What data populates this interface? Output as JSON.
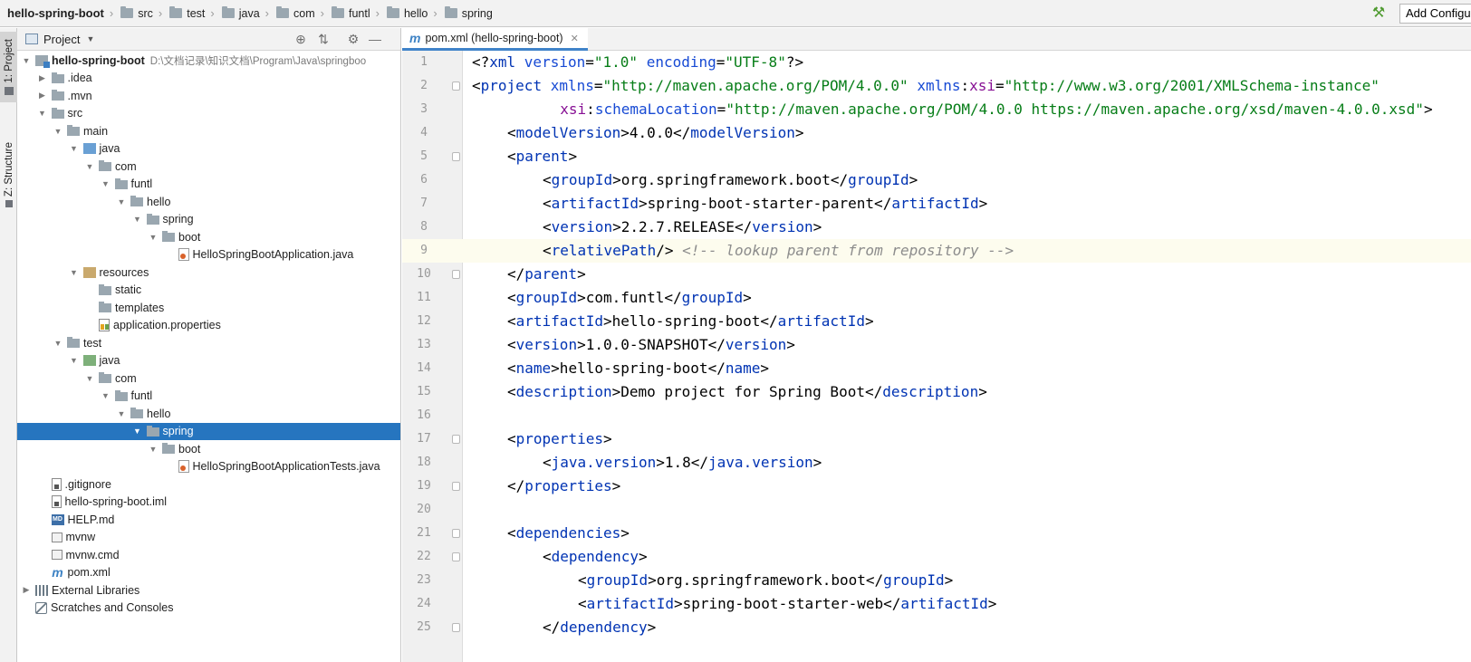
{
  "breadcrumbs": [
    {
      "label": "hello-spring-boot",
      "icon": "folder-icon"
    },
    {
      "label": "src",
      "icon": "folder-icon"
    },
    {
      "label": "test",
      "icon": "folder-icon"
    },
    {
      "label": "java",
      "icon": "folder-icon"
    },
    {
      "label": "com",
      "icon": "folder-icon"
    },
    {
      "label": "funtl",
      "icon": "folder-icon"
    },
    {
      "label": "hello",
      "icon": "folder-icon"
    },
    {
      "label": "spring",
      "icon": "folder-icon"
    }
  ],
  "toolbar": {
    "build_icon": "hammer-icon",
    "add_config_label": "Add Configu"
  },
  "tool_strip": {
    "project_tab": "1: Project",
    "structure_tab": "Z: Structure"
  },
  "project_panel": {
    "title": "Project",
    "header_icons": [
      "locate-icon",
      "collapse-icon",
      "gear-icon",
      "minimize-icon"
    ],
    "tree": [
      {
        "label": "hello-spring-boot",
        "path": "D:\\文档记录\\知识文档\\Program\\Java\\springboo",
        "depth": 0,
        "arrow": "down",
        "icon": "module",
        "bold": true
      },
      {
        "label": ".idea",
        "depth": 1,
        "arrow": "right",
        "icon": "folder"
      },
      {
        "label": ".mvn",
        "depth": 1,
        "arrow": "right",
        "icon": "folder"
      },
      {
        "label": "src",
        "depth": 1,
        "arrow": "down",
        "icon": "folder"
      },
      {
        "label": "main",
        "depth": 2,
        "arrow": "down",
        "icon": "folder"
      },
      {
        "label": "java",
        "depth": 3,
        "arrow": "down",
        "icon": "folder-src"
      },
      {
        "label": "com",
        "depth": 4,
        "arrow": "down",
        "icon": "folder"
      },
      {
        "label": "funtl",
        "depth": 5,
        "arrow": "down",
        "icon": "folder"
      },
      {
        "label": "hello",
        "depth": 6,
        "arrow": "down",
        "icon": "folder"
      },
      {
        "label": "spring",
        "depth": 7,
        "arrow": "down",
        "icon": "folder"
      },
      {
        "label": "boot",
        "depth": 8,
        "arrow": "down",
        "icon": "folder"
      },
      {
        "label": "HelloSpringBootApplication.java",
        "depth": 9,
        "arrow": "",
        "icon": "java"
      },
      {
        "label": "resources",
        "depth": 3,
        "arrow": "down",
        "icon": "folder-res"
      },
      {
        "label": "static",
        "depth": 4,
        "arrow": "",
        "icon": "folder"
      },
      {
        "label": "templates",
        "depth": 4,
        "arrow": "",
        "icon": "folder"
      },
      {
        "label": "application.properties",
        "depth": 4,
        "arrow": "",
        "icon": "props"
      },
      {
        "label": "test",
        "depth": 2,
        "arrow": "down",
        "icon": "folder"
      },
      {
        "label": "java",
        "depth": 3,
        "arrow": "down",
        "icon": "folder-test"
      },
      {
        "label": "com",
        "depth": 4,
        "arrow": "down",
        "icon": "folder"
      },
      {
        "label": "funtl",
        "depth": 5,
        "arrow": "down",
        "icon": "folder"
      },
      {
        "label": "hello",
        "depth": 6,
        "arrow": "down",
        "icon": "folder"
      },
      {
        "label": "spring",
        "depth": 7,
        "arrow": "down",
        "icon": "folder",
        "selected": true
      },
      {
        "label": "boot",
        "depth": 8,
        "arrow": "down",
        "icon": "folder"
      },
      {
        "label": "HelloSpringBootApplicationTests.java",
        "depth": 9,
        "arrow": "",
        "icon": "java"
      },
      {
        "label": ".gitignore",
        "depth": 1,
        "arrow": "",
        "icon": "file"
      },
      {
        "label": "hello-spring-boot.iml",
        "depth": 1,
        "arrow": "",
        "icon": "file"
      },
      {
        "label": "HELP.md",
        "depth": 1,
        "arrow": "",
        "icon": "md"
      },
      {
        "label": "mvnw",
        "depth": 1,
        "arrow": "",
        "icon": "term"
      },
      {
        "label": "mvnw.cmd",
        "depth": 1,
        "arrow": "",
        "icon": "term"
      },
      {
        "label": "pom.xml",
        "depth": 1,
        "arrow": "",
        "icon": "maven"
      },
      {
        "label": "External Libraries",
        "depth": 0,
        "arrow": "right",
        "icon": "libs"
      },
      {
        "label": "Scratches and Consoles",
        "depth": 0,
        "arrow": "",
        "icon": "scratch"
      }
    ]
  },
  "editor": {
    "tab_label": "pom.xml (hello-spring-boot)",
    "tab_icon": "maven-icon",
    "current_line": 9,
    "lines": [
      {
        "n": "1",
        "indent": 0,
        "fold": false,
        "tokens": [
          [
            "ang",
            "<?"
          ],
          [
            "tag",
            "xml "
          ],
          [
            "attr",
            "version"
          ],
          [
            "ang",
            "="
          ],
          [
            "str",
            "\"1.0\""
          ],
          [
            "ang",
            " "
          ],
          [
            "attr",
            "encoding"
          ],
          [
            "ang",
            "="
          ],
          [
            "str",
            "\"UTF-8\""
          ],
          [
            "ang",
            "?>"
          ]
        ]
      },
      {
        "n": "2",
        "indent": 0,
        "fold": true,
        "tokens": [
          [
            "ang",
            "<"
          ],
          [
            "tag",
            "project "
          ],
          [
            "attr",
            "xmlns"
          ],
          [
            "ang",
            "="
          ],
          [
            "str",
            "\"http://maven.apache.org/POM/4.0.0\""
          ],
          [
            "ang",
            " "
          ],
          [
            "attr",
            "xmlns"
          ],
          [
            "ang",
            ":"
          ],
          [
            "ns",
            "xsi"
          ],
          [
            "ang",
            "="
          ],
          [
            "str",
            "\"http://www.w3.org/2001/XMLSchema-instance\""
          ]
        ]
      },
      {
        "n": "3",
        "indent": 2,
        "fold": false,
        "tokens": [
          [
            "ang",
            "  "
          ],
          [
            "ns",
            "xsi"
          ],
          [
            "ang",
            ":"
          ],
          [
            "attr",
            "schemaLocation"
          ],
          [
            "ang",
            "="
          ],
          [
            "str",
            "\"http://maven.apache.org/POM/4.0.0 https://maven.apache.org/xsd/maven-4.0.0.xsd\""
          ],
          [
            "ang",
            ">"
          ]
        ]
      },
      {
        "n": "4",
        "indent": 1,
        "fold": false,
        "tokens": [
          [
            "ang",
            "<"
          ],
          [
            "tag",
            "modelVersion"
          ],
          [
            "ang",
            ">4.0.0</"
          ],
          [
            "tag",
            "modelVersion"
          ],
          [
            "ang",
            ">"
          ]
        ]
      },
      {
        "n": "5",
        "indent": 1,
        "fold": true,
        "tokens": [
          [
            "ang",
            "<"
          ],
          [
            "tag",
            "parent"
          ],
          [
            "ang",
            ">"
          ]
        ]
      },
      {
        "n": "6",
        "indent": 2,
        "fold": false,
        "tokens": [
          [
            "ang",
            "<"
          ],
          [
            "tag",
            "groupId"
          ],
          [
            "ang",
            ">org.springframework.boot</"
          ],
          [
            "tag",
            "groupId"
          ],
          [
            "ang",
            ">"
          ]
        ]
      },
      {
        "n": "7",
        "indent": 2,
        "fold": false,
        "tokens": [
          [
            "ang",
            "<"
          ],
          [
            "tag",
            "artifactId"
          ],
          [
            "ang",
            ">spring-boot-starter-parent</"
          ],
          [
            "tag",
            "artifactId"
          ],
          [
            "ang",
            ">"
          ]
        ]
      },
      {
        "n": "8",
        "indent": 2,
        "fold": false,
        "tokens": [
          [
            "ang",
            "<"
          ],
          [
            "tag",
            "version"
          ],
          [
            "ang",
            ">2.2.7.RELEASE</"
          ],
          [
            "tag",
            "version"
          ],
          [
            "ang",
            ">"
          ]
        ]
      },
      {
        "n": "9",
        "indent": 2,
        "fold": false,
        "tokens": [
          [
            "ang",
            "<"
          ],
          [
            "tag",
            "relativePath"
          ],
          [
            "ang",
            "/> "
          ],
          [
            "cmt",
            "<!-- lookup parent from repository -->"
          ]
        ]
      },
      {
        "n": "10",
        "indent": 1,
        "fold": true,
        "tokens": [
          [
            "ang",
            "</"
          ],
          [
            "tag",
            "parent"
          ],
          [
            "ang",
            ">"
          ]
        ]
      },
      {
        "n": "11",
        "indent": 1,
        "fold": false,
        "tokens": [
          [
            "ang",
            "<"
          ],
          [
            "tag",
            "groupId"
          ],
          [
            "ang",
            ">com.funtl</"
          ],
          [
            "tag",
            "groupId"
          ],
          [
            "ang",
            ">"
          ]
        ]
      },
      {
        "n": "12",
        "indent": 1,
        "fold": false,
        "tokens": [
          [
            "ang",
            "<"
          ],
          [
            "tag",
            "artifactId"
          ],
          [
            "ang",
            ">hello-spring-boot</"
          ],
          [
            "tag",
            "artifactId"
          ],
          [
            "ang",
            ">"
          ]
        ]
      },
      {
        "n": "13",
        "indent": 1,
        "fold": false,
        "tokens": [
          [
            "ang",
            "<"
          ],
          [
            "tag",
            "version"
          ],
          [
            "ang",
            ">1.0.0-SNAPSHOT</"
          ],
          [
            "tag",
            "version"
          ],
          [
            "ang",
            ">"
          ]
        ]
      },
      {
        "n": "14",
        "indent": 1,
        "fold": false,
        "tokens": [
          [
            "ang",
            "<"
          ],
          [
            "tag",
            "name"
          ],
          [
            "ang",
            ">hello-spring-boot</"
          ],
          [
            "tag",
            "name"
          ],
          [
            "ang",
            ">"
          ]
        ]
      },
      {
        "n": "15",
        "indent": 1,
        "fold": false,
        "tokens": [
          [
            "ang",
            "<"
          ],
          [
            "tag",
            "description"
          ],
          [
            "ang",
            ">Demo project for Spring Boot</"
          ],
          [
            "tag",
            "description"
          ],
          [
            "ang",
            ">"
          ]
        ]
      },
      {
        "n": "16",
        "indent": 1,
        "fold": false,
        "tokens": []
      },
      {
        "n": "17",
        "indent": 1,
        "fold": true,
        "tokens": [
          [
            "ang",
            "<"
          ],
          [
            "tag",
            "properties"
          ],
          [
            "ang",
            ">"
          ]
        ]
      },
      {
        "n": "18",
        "indent": 2,
        "fold": false,
        "tokens": [
          [
            "ang",
            "<"
          ],
          [
            "tag",
            "java.version"
          ],
          [
            "ang",
            ">1.8</"
          ],
          [
            "tag",
            "java.version"
          ],
          [
            "ang",
            ">"
          ]
        ]
      },
      {
        "n": "19",
        "indent": 1,
        "fold": true,
        "tokens": [
          [
            "ang",
            "</"
          ],
          [
            "tag",
            "properties"
          ],
          [
            "ang",
            ">"
          ]
        ]
      },
      {
        "n": "20",
        "indent": 1,
        "fold": false,
        "tokens": []
      },
      {
        "n": "21",
        "indent": 1,
        "fold": true,
        "tokens": [
          [
            "ang",
            "<"
          ],
          [
            "tag",
            "dependencies"
          ],
          [
            "ang",
            ">"
          ]
        ]
      },
      {
        "n": "22",
        "indent": 2,
        "fold": true,
        "tokens": [
          [
            "ang",
            "<"
          ],
          [
            "tag",
            "dependency"
          ],
          [
            "ang",
            ">"
          ]
        ]
      },
      {
        "n": "23",
        "indent": 3,
        "fold": false,
        "tokens": [
          [
            "ang",
            "<"
          ],
          [
            "tag",
            "groupId"
          ],
          [
            "ang",
            ">org.springframework.boot</"
          ],
          [
            "tag",
            "groupId"
          ],
          [
            "ang",
            ">"
          ]
        ]
      },
      {
        "n": "24",
        "indent": 3,
        "fold": false,
        "tokens": [
          [
            "ang",
            "<"
          ],
          [
            "tag",
            "artifactId"
          ],
          [
            "ang",
            ">spring-boot-starter-web</"
          ],
          [
            "tag",
            "artifactId"
          ],
          [
            "ang",
            ">"
          ]
        ]
      },
      {
        "n": "25",
        "indent": 2,
        "fold": true,
        "tokens": [
          [
            "ang",
            "</"
          ],
          [
            "tag",
            "dependency"
          ],
          [
            "ang",
            ">"
          ]
        ]
      }
    ]
  }
}
